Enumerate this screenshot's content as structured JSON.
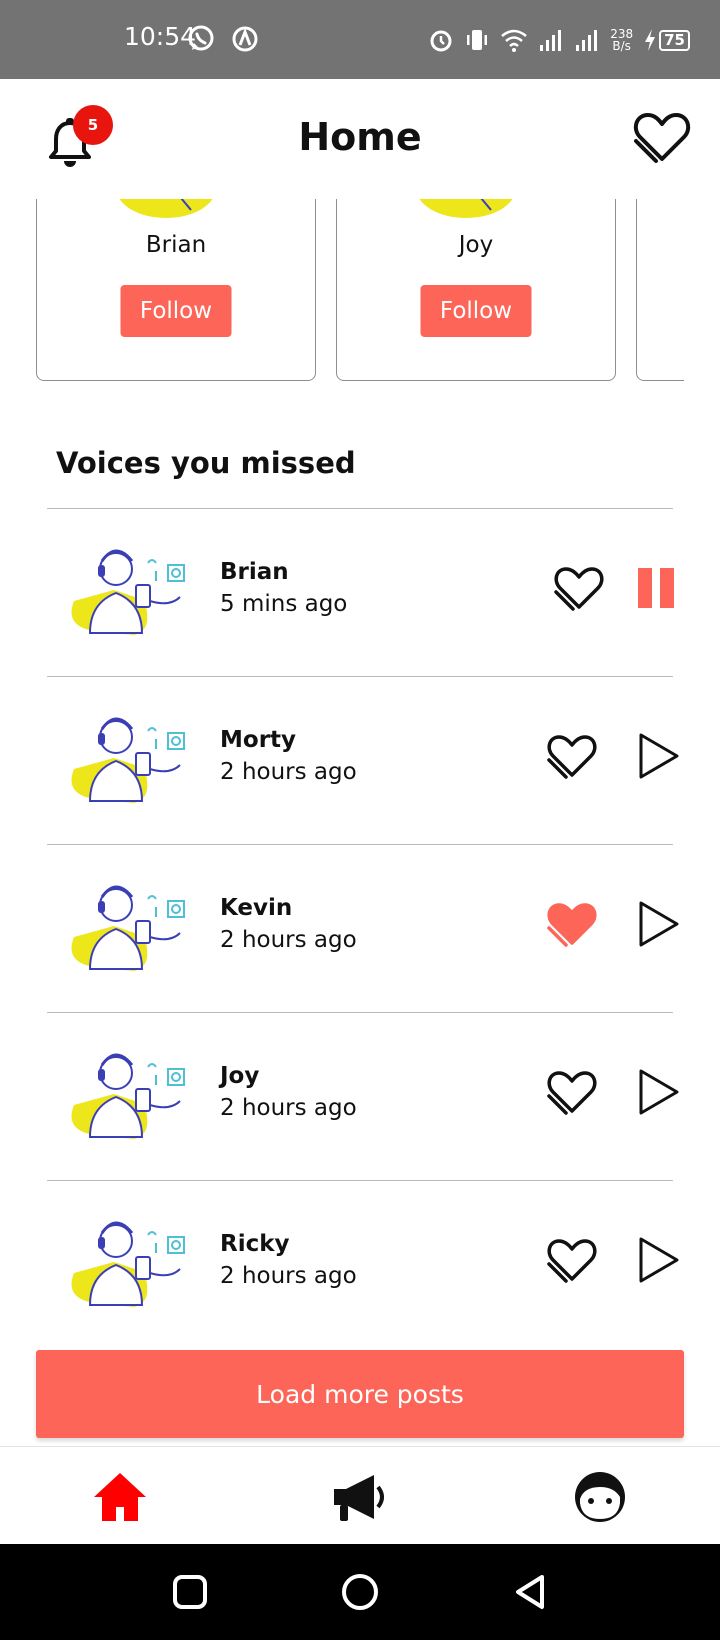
{
  "status_bar": {
    "time": "10:54",
    "net_speed_value": "238",
    "net_speed_unit": "B/s",
    "battery": "75",
    "icons": [
      "whatsapp-icon",
      "vpn-icon",
      "alarm-icon",
      "vibrate-icon",
      "wifi-icon",
      "signal-icon",
      "signal-icon",
      "charging-icon",
      "battery-icon"
    ]
  },
  "header": {
    "title": "Home",
    "notification_count": "5",
    "icons": [
      "bell-icon",
      "favorites-heart-icon"
    ]
  },
  "suggestions": [
    {
      "name": "Brian",
      "follow_label": "Follow"
    },
    {
      "name": "Joy",
      "follow_label": "Follow"
    },
    {
      "name": "",
      "follow_label": ""
    }
  ],
  "voices_section": {
    "title": "Voices you missed",
    "posts": [
      {
        "name": "Brian",
        "time": "5 mins ago",
        "liked": false,
        "playing": true
      },
      {
        "name": "Morty",
        "time": "2 hours ago",
        "liked": false,
        "playing": false
      },
      {
        "name": "Kevin",
        "time": "2 hours ago",
        "liked": true,
        "playing": false
      },
      {
        "name": "Joy",
        "time": "2 hours ago",
        "liked": false,
        "playing": false
      },
      {
        "name": "Ricky",
        "time": "2 hours ago",
        "liked": false,
        "playing": false
      }
    ]
  },
  "load_more_label": "Load more posts",
  "bottom_nav": {
    "items": [
      {
        "icon": "home-icon",
        "active": true
      },
      {
        "icon": "megaphone-icon",
        "active": false
      },
      {
        "icon": "profile-face-icon",
        "active": false
      }
    ]
  },
  "colors": {
    "accent": "#fc6557",
    "badge": "#e8150e",
    "nav_active": "#ff0000",
    "status_bar": "#737373",
    "art_yellow": "#ece61b",
    "art_blue": "#3b3fb5"
  }
}
